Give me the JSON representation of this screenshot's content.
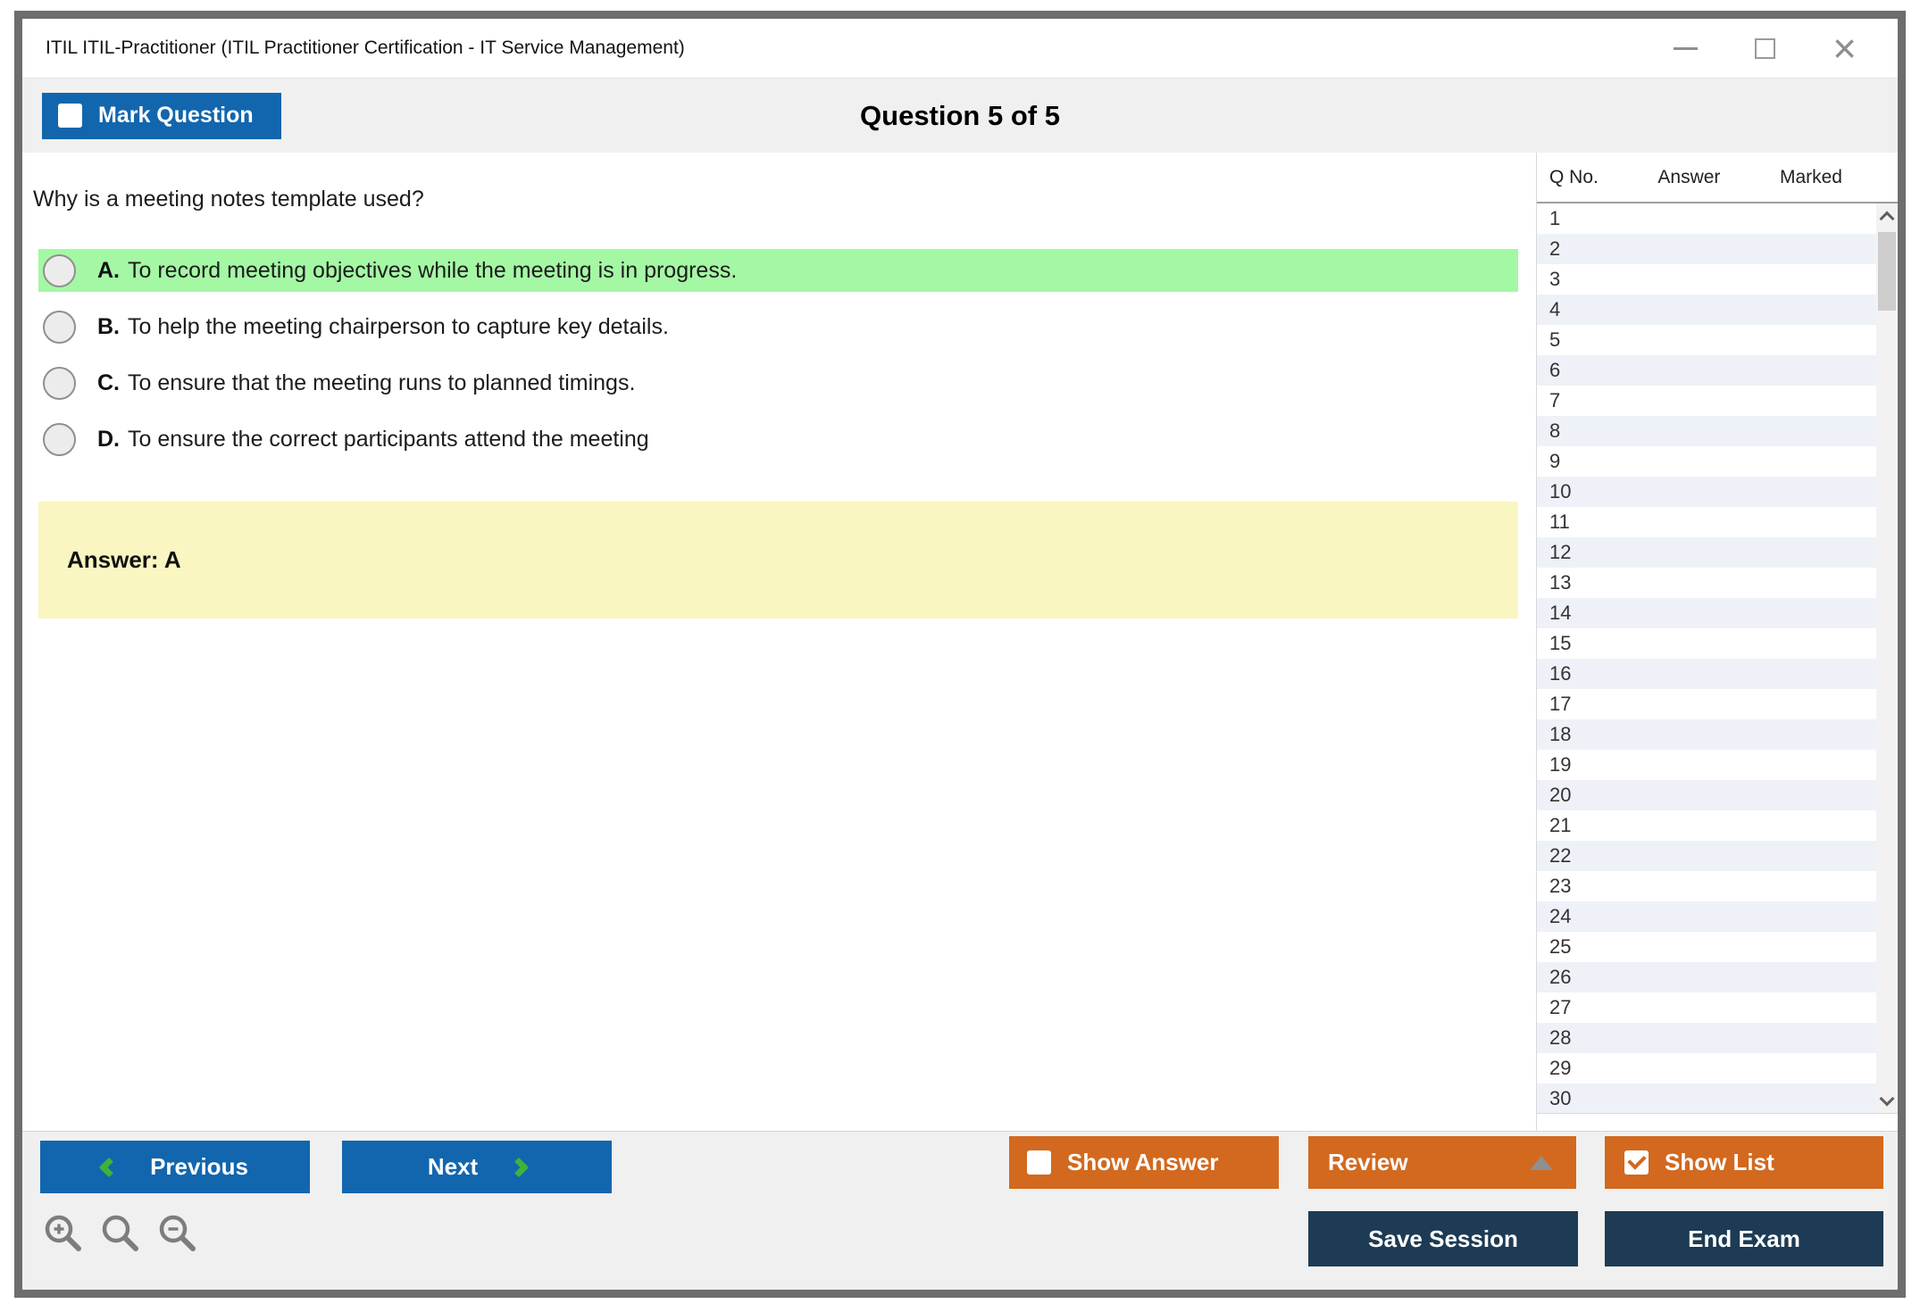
{
  "window": {
    "title": "ITIL ITIL-Practitioner (ITIL Practitioner Certification - IT Service Management)",
    "close_icon": "×"
  },
  "header": {
    "mark_question_label": "Mark Question",
    "question_counter": "Question 5 of 5"
  },
  "question": {
    "text": "Why is a meeting notes template used?",
    "options": [
      {
        "letter": "A.",
        "text": "To record meeting objectives while the meeting is in progress.",
        "highlighted": true
      },
      {
        "letter": "B.",
        "text": "To help the meeting chairperson to capture key details.",
        "highlighted": false
      },
      {
        "letter": "C.",
        "text": "To ensure that the meeting runs to planned timings.",
        "highlighted": false
      },
      {
        "letter": "D.",
        "text": "To ensure the correct participants attend the meeting",
        "highlighted": false
      }
    ],
    "answer_label": "Answer: A"
  },
  "sidebar": {
    "columns": {
      "qno": "Q No.",
      "answer": "Answer",
      "marked": "Marked"
    },
    "rows": [
      {
        "q": "1",
        "answer": "",
        "marked": ""
      },
      {
        "q": "2",
        "answer": "",
        "marked": ""
      },
      {
        "q": "3",
        "answer": "",
        "marked": ""
      },
      {
        "q": "4",
        "answer": "",
        "marked": ""
      },
      {
        "q": "5",
        "answer": "",
        "marked": ""
      },
      {
        "q": "6",
        "answer": "",
        "marked": ""
      },
      {
        "q": "7",
        "answer": "",
        "marked": ""
      },
      {
        "q": "8",
        "answer": "",
        "marked": ""
      },
      {
        "q": "9",
        "answer": "",
        "marked": ""
      },
      {
        "q": "10",
        "answer": "",
        "marked": ""
      },
      {
        "q": "11",
        "answer": "",
        "marked": ""
      },
      {
        "q": "12",
        "answer": "",
        "marked": ""
      },
      {
        "q": "13",
        "answer": "",
        "marked": ""
      },
      {
        "q": "14",
        "answer": "",
        "marked": ""
      },
      {
        "q": "15",
        "answer": "",
        "marked": ""
      },
      {
        "q": "16",
        "answer": "",
        "marked": ""
      },
      {
        "q": "17",
        "answer": "",
        "marked": ""
      },
      {
        "q": "18",
        "answer": "",
        "marked": ""
      },
      {
        "q": "19",
        "answer": "",
        "marked": ""
      },
      {
        "q": "20",
        "answer": "",
        "marked": ""
      },
      {
        "q": "21",
        "answer": "",
        "marked": ""
      },
      {
        "q": "22",
        "answer": "",
        "marked": ""
      },
      {
        "q": "23",
        "answer": "",
        "marked": ""
      },
      {
        "q": "24",
        "answer": "",
        "marked": ""
      },
      {
        "q": "25",
        "answer": "",
        "marked": ""
      },
      {
        "q": "26",
        "answer": "",
        "marked": ""
      },
      {
        "q": "27",
        "answer": "",
        "marked": ""
      },
      {
        "q": "28",
        "answer": "",
        "marked": ""
      },
      {
        "q": "29",
        "answer": "",
        "marked": ""
      },
      {
        "q": "30",
        "answer": "",
        "marked": ""
      }
    ]
  },
  "footer": {
    "previous_label": "Previous",
    "next_label": "Next",
    "show_answer_label": "Show Answer",
    "review_label": "Review",
    "show_list_label": "Show List",
    "save_session_label": "Save Session",
    "end_exam_label": "End Exam"
  },
  "colors": {
    "accent-blue": "#1266ae",
    "accent-orange": "#d2691e",
    "navy": "#1d3b54",
    "chev-green": "#3eb339",
    "highlight-green": "#a4f8a4",
    "answer-yellow": "#faf6c1",
    "row-tint": "#eef2f8"
  }
}
